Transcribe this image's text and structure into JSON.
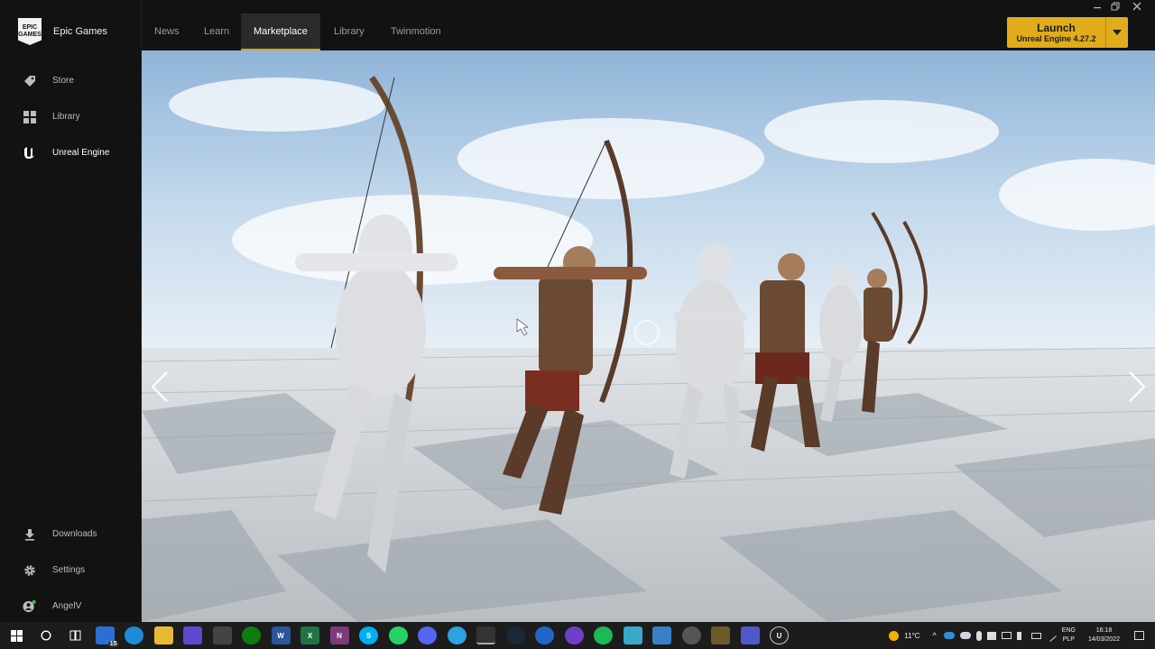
{
  "sidebar": {
    "brand": {
      "logo_line1": "EPIC",
      "logo_line2": "GAMES",
      "name": "Epic Games"
    },
    "items": [
      {
        "label": "Store",
        "icon": "tag-icon"
      },
      {
        "label": "Library",
        "icon": "grid-icon"
      },
      {
        "label": "Unreal Engine",
        "icon": "unreal-logo-icon",
        "active": true
      }
    ],
    "bottom": [
      {
        "label": "Downloads",
        "icon": "download-icon"
      },
      {
        "label": "Settings",
        "icon": "gear-icon"
      },
      {
        "label": "AngelV",
        "icon": "user-avatar-icon",
        "status": "online"
      }
    ]
  },
  "tabs": [
    {
      "label": "News"
    },
    {
      "label": "Learn"
    },
    {
      "label": "Marketplace",
      "active": true
    },
    {
      "label": "Library"
    },
    {
      "label": "Twinmotion"
    }
  ],
  "launch": {
    "label": "Launch",
    "sublabel": "Unreal Engine 4.27.2"
  },
  "window_controls": [
    "minimize-icon",
    "restore-icon",
    "close-icon"
  ],
  "viewer": {
    "prev_icon": "chevron-left-icon",
    "next_icon": "chevron-right-icon"
  },
  "taskbar": {
    "apps": [
      "windows-start-icon",
      "cortana-search-icon",
      "task-view-icon",
      "mail-icon",
      "edge-icon",
      "file-explorer-icon",
      "app-icon",
      "unity-icon",
      "xbox-icon",
      "word-icon",
      "excel-icon",
      "onenote-icon",
      "skype-icon",
      "whatsapp-icon",
      "discord-icon",
      "telegram-icon",
      "epic-games-icon",
      "steam-icon",
      "maps-icon",
      "github-icon",
      "spotify-icon",
      "app-icon",
      "app-icon",
      "app-icon",
      "app-icon",
      "teams-icon",
      "unreal-icon"
    ],
    "mail_badge": "15",
    "weather": "11°C",
    "lang_1": "ENG",
    "lang_2": "PLP",
    "time": "16:18",
    "date": "14/03/2022"
  },
  "colors": {
    "accent": "#d6a524",
    "launch": "#e0ac1c",
    "bg": "#121212"
  }
}
